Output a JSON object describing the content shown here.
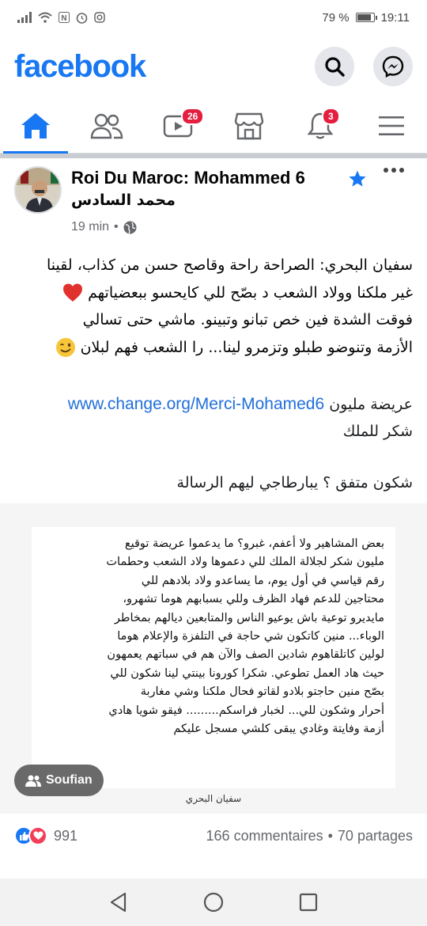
{
  "status_bar": {
    "battery_text": "79 %",
    "battery_level": 0.79,
    "time": "19:11"
  },
  "header": {
    "logo": "facebook",
    "search_icon": "search-icon",
    "messenger_icon": "messenger-icon"
  },
  "tabs": [
    {
      "name": "home",
      "icon": "home-icon",
      "active": true,
      "badge": ""
    },
    {
      "name": "friends",
      "icon": "friends-icon",
      "active": false,
      "badge": ""
    },
    {
      "name": "watch",
      "icon": "video-icon",
      "active": false,
      "badge": "26"
    },
    {
      "name": "marketplace",
      "icon": "store-icon",
      "active": false,
      "badge": ""
    },
    {
      "name": "notifications",
      "icon": "bell-icon",
      "active": false,
      "badge": "3"
    },
    {
      "name": "menu",
      "icon": "menu-icon",
      "active": false,
      "badge": ""
    }
  ],
  "post": {
    "author": "Roi Du Maroc: Mohammed 6",
    "author_sub": "محمد السادس",
    "time": "19 min",
    "separator": "•",
    "text_line1": "سفيان البحري: الصراحة راحة وقاصح حسن من كذاب، لقينا",
    "text_line2": "غير ملكنا وولاد الشعب د بصّح للي كايحسو ببعضياتهم",
    "text_line3": "فوقت الشدة فين خص تبانو وتبينو. ماشي حتى تسالي",
    "text_line4": "الأزمة وتنوضو طبلو وتزمرو لينا... را الشعب فهم لبلان",
    "petition_prefix": "عريضة مليون",
    "link": "www.change.org/Merci-Mohamed6",
    "petition_suffix": "شكر للملك",
    "question": "شكون متفق ؟ يبارطاجي ليهم الرسالة",
    "image_text": [
      "بعض المشاهير ولا أعفم، غبرو؟ ما يدعموا عريضة توقيع",
      "مليون شكر لجلالة الملك للي دعموها ولاد الشعب وحطمات",
      "رقم قياسي في أول يوم، ما يساعدو ولاد بلادهم للي",
      "محتاجين للدعم فهاد الظرف وللي بسبابهم هوما تشهرو،",
      "مايديرو توعية باش يوعيو الناس والمتابعين ديالهم بمخاطر",
      "الوباء... منين كاتكون شي حاجة في التلفزة والإعلام هوما",
      "لولين كاتلقاهوم شادين الصف والآن هم في سباتهم يعمهون",
      "حيث هاد العمل تطوعي. شكرا كورونا بينتي لينا شكون للي",
      "بصّح منين حاجتو بلادو لقاتو فحال ملكنا وشي مغاربة",
      "أحرار وشكون للي... لخبار فراسكم......... فيقو شويا هادي",
      "أزمة وفايتة وغادي يبقى كلشي مسجل عليكم"
    ],
    "image_signature": "سفيان البحري",
    "tag_label": "Soufian",
    "reaction_count": "991",
    "comments": "166 commentaires",
    "dot": "•",
    "shares": "70 partages"
  },
  "colors": {
    "brand": "#1877f2",
    "badge": "#e41e3f",
    "link": "#216fdb"
  }
}
